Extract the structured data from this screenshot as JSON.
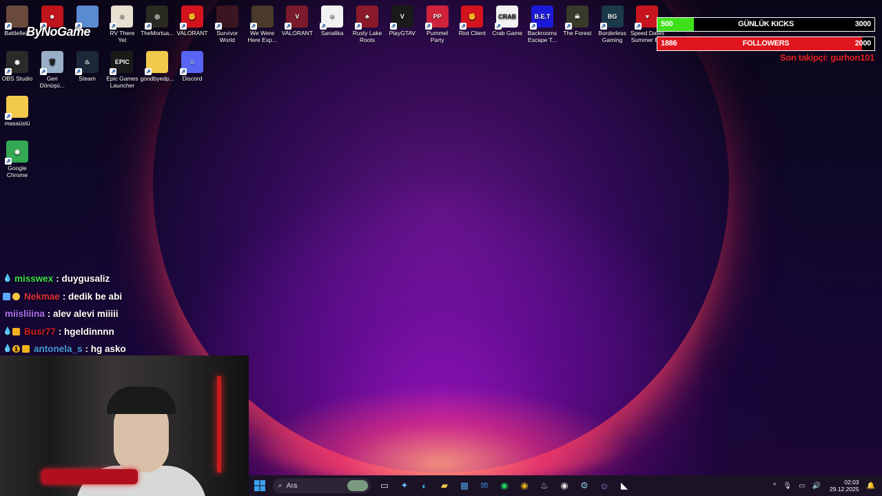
{
  "desktop_icons": [
    {
      "label": "Battlefield",
      "icon": "battlefield-icon",
      "color": "#6a4a3a",
      "glyph": ""
    },
    {
      "label": "",
      "icon": "red-mascot-icon",
      "color": "#c0141c",
      "glyph": "☻"
    },
    {
      "label": "",
      "icon": "anime-girl-icon",
      "color": "#5a8ad0",
      "glyph": ""
    },
    {
      "label": "RV There Yet",
      "icon": "rv-there-yet-icon",
      "color": "#e8e0d0",
      "glyph": "☺"
    },
    {
      "label": "TheMortua...",
      "icon": "mortuary-icon",
      "color": "#2a2a22",
      "glyph": "◎"
    },
    {
      "label": "VALORANT",
      "icon": "riot-fist-icon",
      "color": "#d3141e",
      "glyph": "✊"
    },
    {
      "label": "Survivor World",
      "icon": "survivor-world-icon",
      "color": "#3a1620",
      "glyph": ""
    },
    {
      "label": "We Were Here Exp...",
      "icon": "we-were-here-icon",
      "color": "#4a3a2a",
      "glyph": ""
    },
    {
      "label": "VALORANT",
      "icon": "valorant-icon",
      "color": "#7a1a2a",
      "glyph": "V"
    },
    {
      "label": "Sanalika",
      "icon": "sanalika-icon",
      "color": "#f2f2f2",
      "glyph": "☺"
    },
    {
      "label": "Rusty Lake Roots",
      "icon": "rusty-lake-icon",
      "color": "#8a1a2a",
      "glyph": "♣"
    },
    {
      "label": "PlayGTAV",
      "icon": "gtav-icon",
      "color": "#1a1a1a",
      "glyph": "V"
    },
    {
      "label": "Pummel Party",
      "icon": "pummel-party-icon",
      "color": "#d0223a",
      "glyph": "PP"
    },
    {
      "label": "Riot Client",
      "icon": "riot-client-icon",
      "color": "#d3141e",
      "glyph": "✊"
    },
    {
      "label": "Crab Game",
      "icon": "crab-game-icon",
      "color": "#f2f2f2",
      "glyph": "CRAB"
    },
    {
      "label": "Backrooms Escape T...",
      "icon": "backrooms-icon",
      "color": "#1a1ad8",
      "glyph": "B.E.T"
    },
    {
      "label": "The Forest",
      "icon": "the-forest-icon",
      "color": "#3a3a2a",
      "glyph": "☠"
    },
    {
      "label": "Borderless Gaming",
      "icon": "borderless-gaming-icon",
      "color": "#1a3a4a",
      "glyph": "BG"
    },
    {
      "label": "Speed Dates Summer E...",
      "icon": "speed-dates-icon",
      "color": "#c8141e",
      "glyph": "♥"
    },
    {
      "label": "OBS Studio",
      "icon": "obs-icon",
      "color": "#2a2a2a",
      "glyph": "◉"
    },
    {
      "label": "Geri Dönüşü...",
      "icon": "recycle-bin-icon",
      "color": "#9ab0c8",
      "glyph": "🗑"
    },
    {
      "label": "Steam",
      "icon": "steam-icon",
      "color": "#1b2838",
      "glyph": "♨"
    },
    {
      "label": "Epic Games Launcher",
      "icon": "epic-games-icon",
      "color": "#1a1a1a",
      "glyph": "EPIC"
    },
    {
      "label": "goodbyedp...",
      "icon": "folder-icon",
      "color": "#f2c94c",
      "glyph": ""
    },
    {
      "label": "Discord",
      "icon": "discord-icon",
      "color": "#5865f2",
      "glyph": "☺"
    },
    {
      "label": "masaüstü",
      "icon": "folder-icon",
      "color": "#f2c94c",
      "glyph": ""
    },
    {
      "label": "Google Chrome",
      "icon": "chrome-icon",
      "color": "#34a853",
      "glyph": "◉"
    }
  ],
  "watermark": "ByNoGame",
  "goal_bars": [
    {
      "left": "500",
      "center": "GÜNLÜK KICKS",
      "right": "3000",
      "color": "#3ee01a",
      "progress": 0.167
    },
    {
      "left": "1886",
      "center": "FOLLOWERS",
      "right": "2000",
      "color": "#e0141c",
      "progress": 0.943
    }
  ],
  "last_follower": "Son takipçi: gurhon101",
  "chat": [
    {
      "badges": [
        "drop"
      ],
      "user": "misswex",
      "color": "#3ee04a",
      "text": ": duygusaliz"
    },
    {
      "badges": [
        "gem",
        "hand"
      ],
      "user": "Nekmae",
      "color": "#e0303a",
      "text": ": dedik be abi"
    },
    {
      "badges": [],
      "user": "miisliiina",
      "color": "#b070f0",
      "text": ": alev alevi miiiii"
    },
    {
      "badges": [
        "drop",
        "crown"
      ],
      "user": "Busr77",
      "color": "#d01e1e",
      "text": ": hgeldinnnn"
    },
    {
      "badges": [
        "drop",
        "one",
        "crown"
      ],
      "user": "antonela_s",
      "color": "#4a9ae0",
      "text": ": hg asko"
    }
  ],
  "taskbar": {
    "search_placeholder": "Ara",
    "apps": [
      {
        "name": "task-view-icon",
        "glyph": "▭",
        "color": "#ddd"
      },
      {
        "name": "copilot-icon",
        "glyph": "✦",
        "color": "#6ac0ff"
      },
      {
        "name": "edge-icon",
        "glyph": "◐",
        "color": "#2fb0e0"
      },
      {
        "name": "file-explorer-icon",
        "glyph": "▰",
        "color": "#f2c94c"
      },
      {
        "name": "store-icon",
        "glyph": "▦",
        "color": "#4a9ae0"
      },
      {
        "name": "mail-icon",
        "glyph": "✉",
        "color": "#3a8ae0"
      },
      {
        "name": "spotify-icon",
        "glyph": "◉",
        "color": "#1ed760"
      },
      {
        "name": "chrome-icon",
        "glyph": "◉",
        "color": "#e0b020"
      },
      {
        "name": "steam-icon",
        "glyph": "♨",
        "color": "#ddd"
      },
      {
        "name": "obs-icon",
        "glyph": "◉",
        "color": "#ddd"
      },
      {
        "name": "settings-app-icon",
        "glyph": "⚙",
        "color": "#8ac0e0"
      },
      {
        "name": "discord-icon",
        "glyph": "☺",
        "color": "#8a90f2"
      },
      {
        "name": "streaming-app-icon",
        "glyph": "◣",
        "color": "#fff"
      }
    ],
    "time": "02:03",
    "date": "29.12.2025"
  }
}
